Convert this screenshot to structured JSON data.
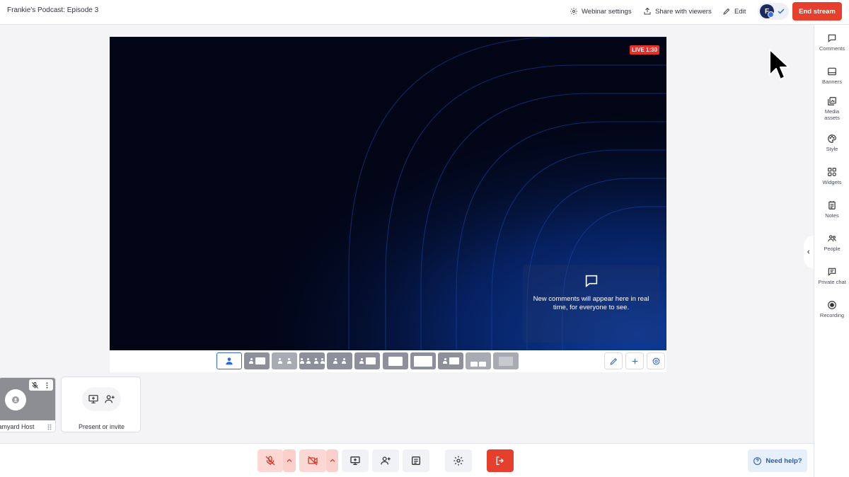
{
  "header": {
    "title": "Frankie's Podcast: Episode 3",
    "webinar_settings": "Webinar settings",
    "share_with_viewers": "Share with viewers",
    "edit": "Edit",
    "avatar_initial": "F",
    "end_stream": "End stream"
  },
  "sidebar": {
    "items": [
      {
        "label": "Comments",
        "icon": "comment-icon"
      },
      {
        "label": "Banners",
        "icon": "banner-icon"
      },
      {
        "label": "Media assets",
        "icon": "media-assets-icon"
      },
      {
        "label": "Style",
        "icon": "palette-icon"
      },
      {
        "label": "Widgets",
        "icon": "widgets-icon"
      },
      {
        "label": "Notes",
        "icon": "notes-icon"
      },
      {
        "label": "People",
        "icon": "people-icon"
      },
      {
        "label": "Private chat",
        "icon": "private-chat-icon"
      },
      {
        "label": "Recording",
        "icon": "record-icon"
      }
    ]
  },
  "stage": {
    "live_badge": "LIVE 1:30",
    "comments_message": "New comments will appear here in real time, for everyone to see."
  },
  "participants": {
    "host_name": "Streamyard Host",
    "present_or_invite": "Present or invite"
  },
  "help": {
    "label": "Need help?"
  },
  "colors": {
    "accent": "#2f69d9",
    "danger": "#e5402d",
    "stage_bg": "#020515",
    "stage_glow": "#0d3b9a"
  }
}
